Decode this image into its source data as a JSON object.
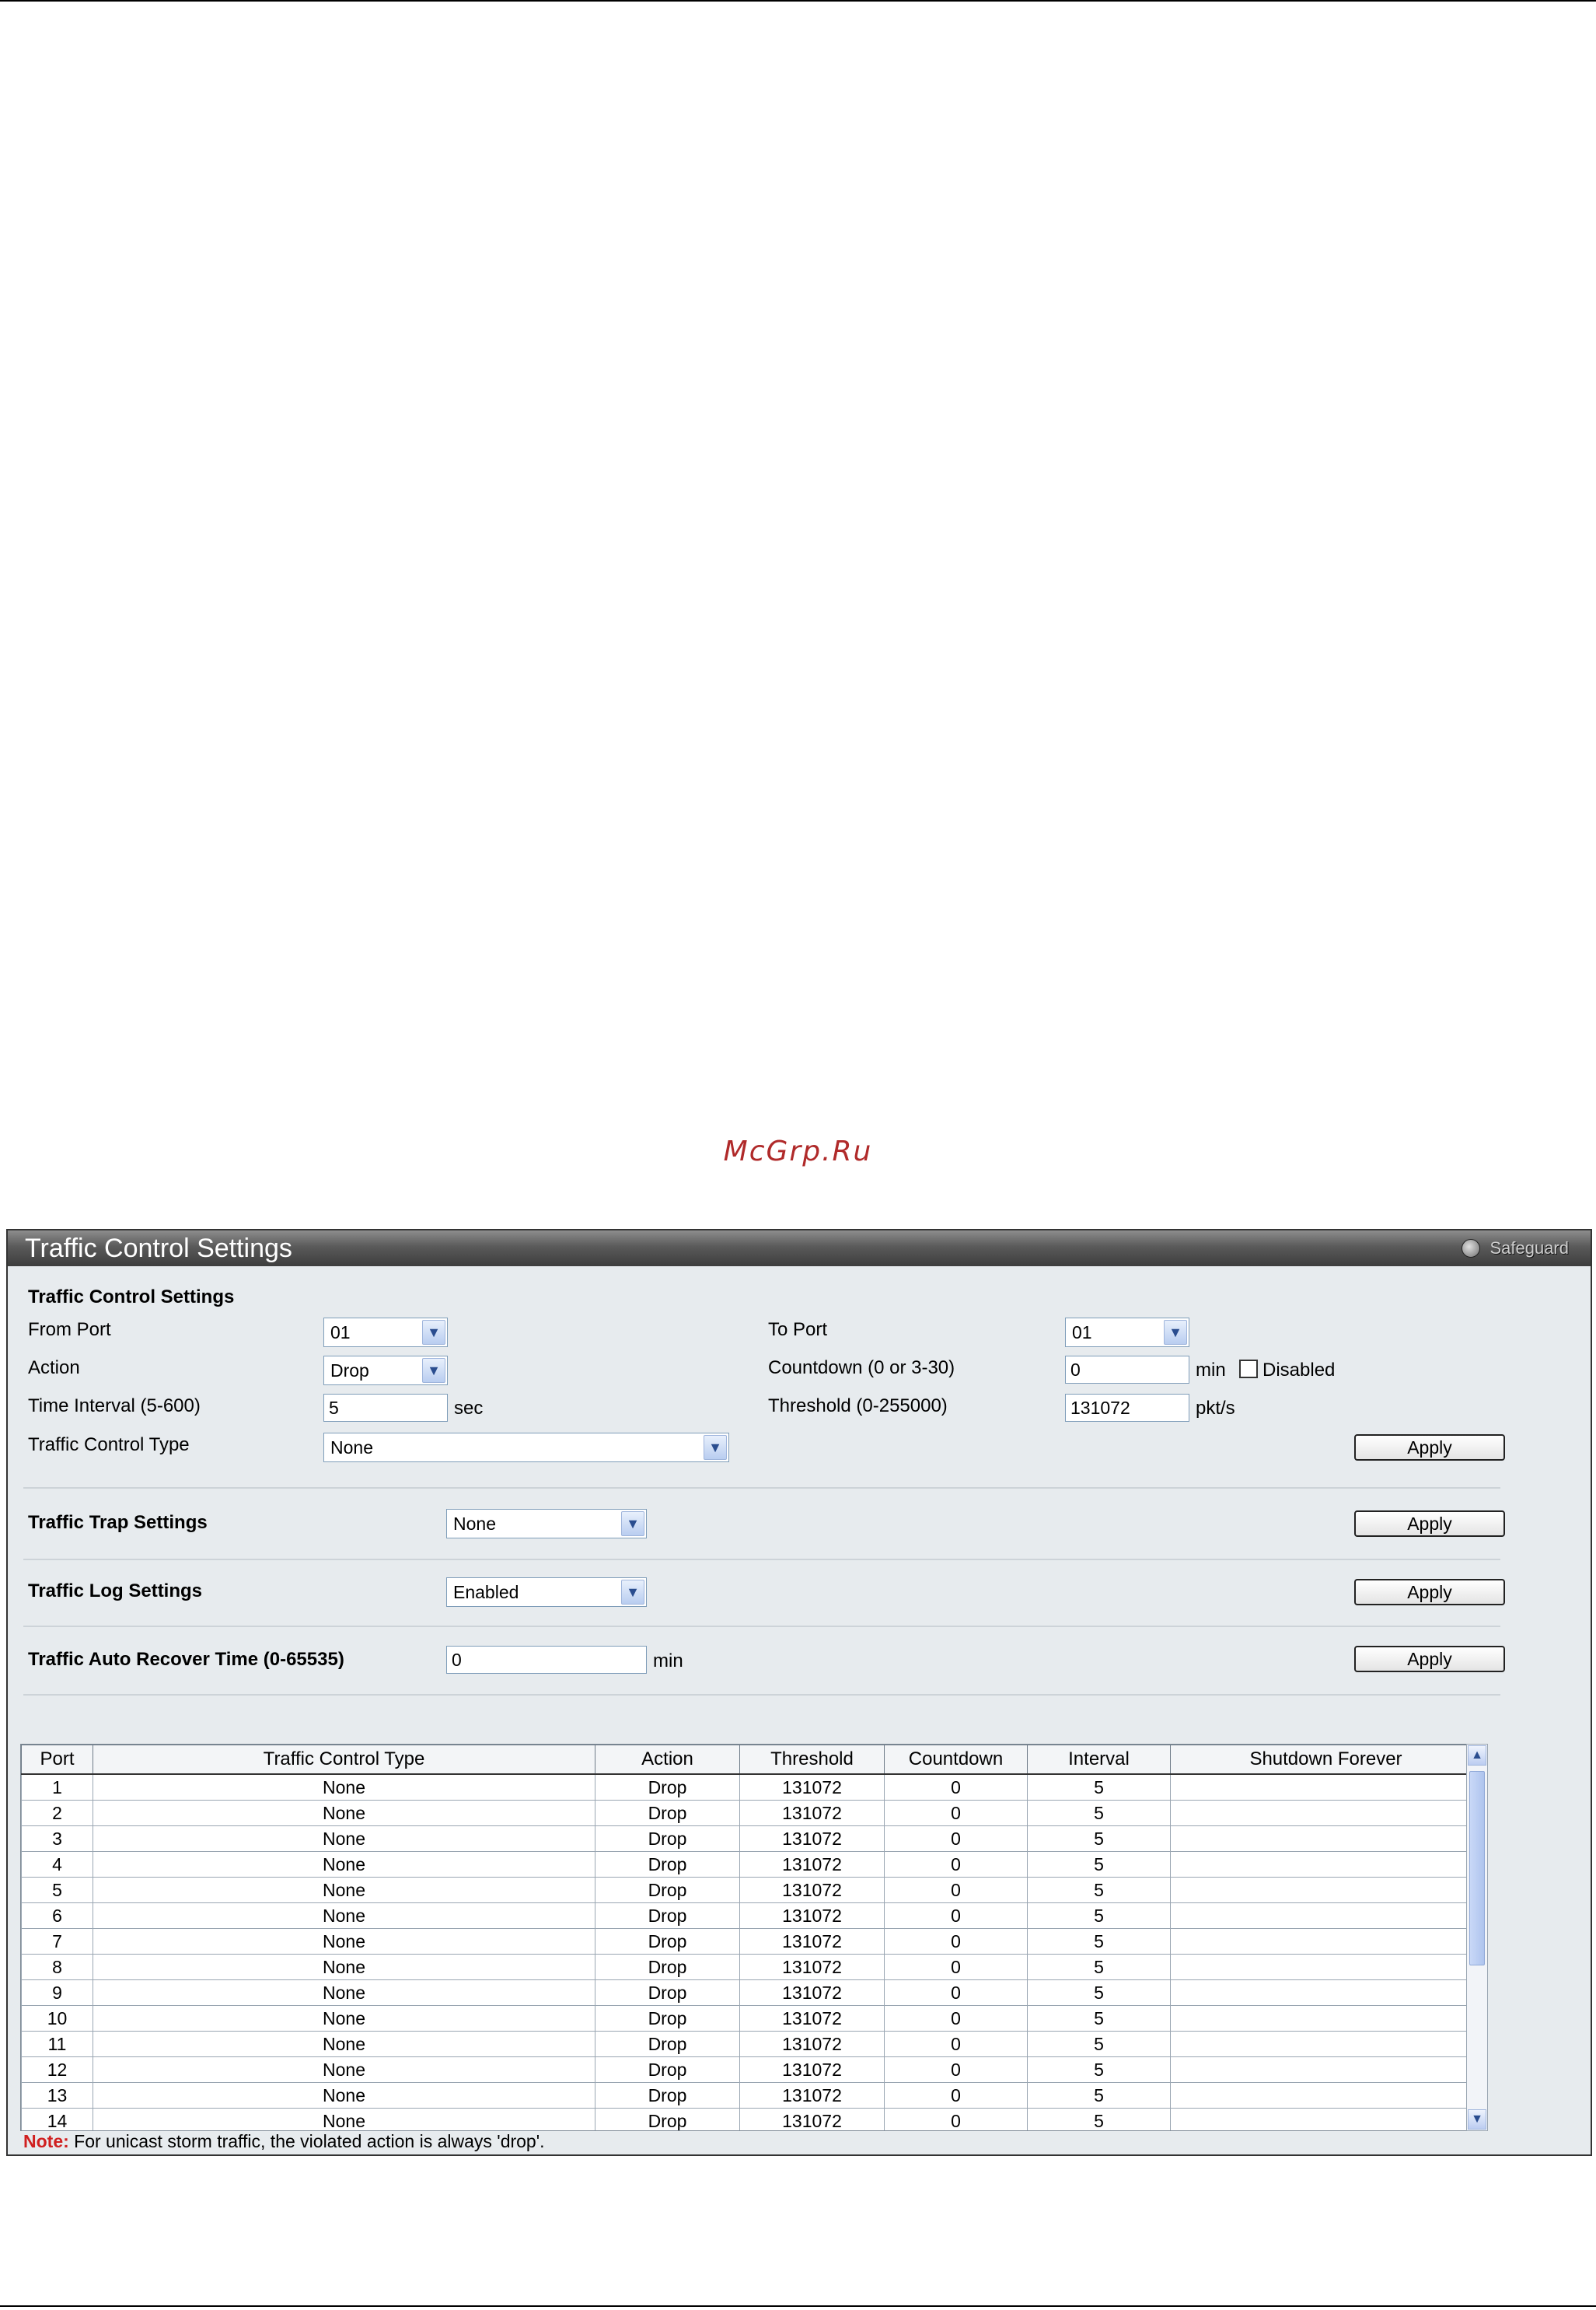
{
  "watermark": "McGrp.Ru",
  "panel": {
    "title": "Traffic Control Settings",
    "safeguard": "Safeguard"
  },
  "tcs": {
    "section_title": "Traffic Control Settings",
    "from_port_label": "From Port",
    "from_port_value": "01",
    "to_port_label": "To Port",
    "to_port_value": "01",
    "action_label": "Action",
    "action_value": "Drop",
    "countdown_label": "Countdown (0 or 3-30)",
    "countdown_value": "0",
    "countdown_unit": "min",
    "disabled_label": "Disabled",
    "interval_label": "Time Interval (5-600)",
    "interval_value": "5",
    "interval_unit": "sec",
    "threshold_label": "Threshold (0-255000)",
    "threshold_value": "131072",
    "threshold_unit": "pkt/s",
    "type_label": "Traffic Control Type",
    "type_value": "None",
    "apply": "Apply"
  },
  "trap": {
    "label": "Traffic Trap Settings",
    "value": "None",
    "apply": "Apply"
  },
  "log": {
    "label": "Traffic Log Settings",
    "value": "Enabled",
    "apply": "Apply"
  },
  "recover": {
    "label": "Traffic Auto Recover Time (0-65535)",
    "value": "0",
    "unit": "min",
    "apply": "Apply"
  },
  "table": {
    "headers": [
      "Port",
      "Traffic Control Type",
      "Action",
      "Threshold",
      "Countdown",
      "Interval",
      "Shutdown Forever"
    ],
    "rows": [
      [
        "1",
        "None",
        "Drop",
        "131072",
        "0",
        "5",
        ""
      ],
      [
        "2",
        "None",
        "Drop",
        "131072",
        "0",
        "5",
        ""
      ],
      [
        "3",
        "None",
        "Drop",
        "131072",
        "0",
        "5",
        ""
      ],
      [
        "4",
        "None",
        "Drop",
        "131072",
        "0",
        "5",
        ""
      ],
      [
        "5",
        "None",
        "Drop",
        "131072",
        "0",
        "5",
        ""
      ],
      [
        "6",
        "None",
        "Drop",
        "131072",
        "0",
        "5",
        ""
      ],
      [
        "7",
        "None",
        "Drop",
        "131072",
        "0",
        "5",
        ""
      ],
      [
        "8",
        "None",
        "Drop",
        "131072",
        "0",
        "5",
        ""
      ],
      [
        "9",
        "None",
        "Drop",
        "131072",
        "0",
        "5",
        ""
      ],
      [
        "10",
        "None",
        "Drop",
        "131072",
        "0",
        "5",
        ""
      ],
      [
        "11",
        "None",
        "Drop",
        "131072",
        "0",
        "5",
        ""
      ],
      [
        "12",
        "None",
        "Drop",
        "131072",
        "0",
        "5",
        ""
      ],
      [
        "13",
        "None",
        "Drop",
        "131072",
        "0",
        "5",
        ""
      ],
      [
        "14",
        "None",
        "Drop",
        "131072",
        "0",
        "5",
        ""
      ]
    ]
  },
  "note": {
    "prefix": "Note:",
    "text": " For unicast storm traffic, the violated action is always 'drop'."
  },
  "icons": {
    "dropdown": "chevron-down-icon",
    "scroll_up": "scroll-up-icon",
    "scroll_down": "scroll-down-icon",
    "safeguard": "safeguard-indicator-icon"
  }
}
